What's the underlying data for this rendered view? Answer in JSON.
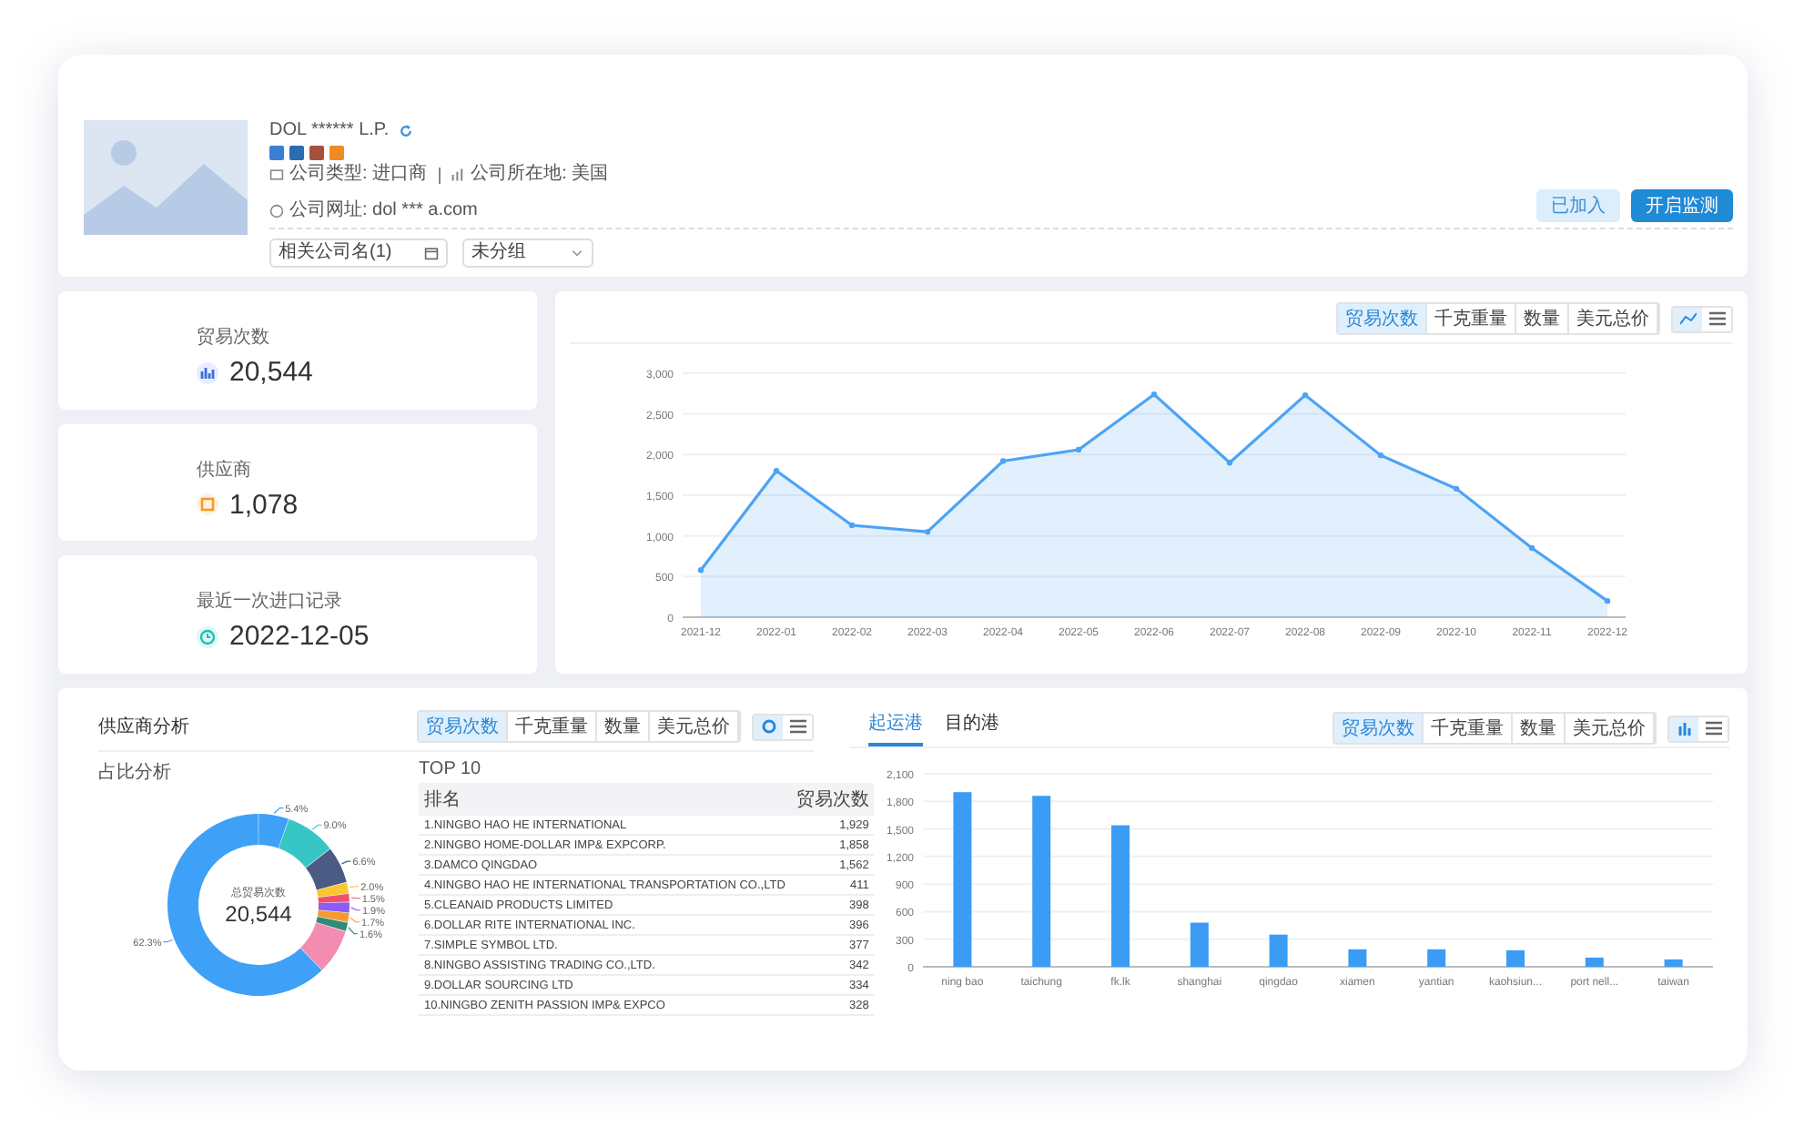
{
  "company": {
    "name": "DOL ****** L.P.",
    "social_links": [
      {
        "color": "#3b7fd4"
      },
      {
        "color": "#2a6db5"
      },
      {
        "color": "#a8503e"
      },
      {
        "color": "#f08a24"
      }
    ],
    "details": [
      {
        "kind": "type",
        "text": "公司类型: 进口商"
      },
      {
        "kind": "location",
        "text": "公司所在地: 美国"
      },
      {
        "kind": "website",
        "text": "公司网址: dol *** a.com"
      }
    ],
    "selects": [
      {
        "kind": "date",
        "value": "相关公司名(1)"
      },
      {
        "kind": "dropdown",
        "value": "未分组"
      }
    ],
    "buttons": [
      {
        "label": "已加入",
        "kind": "secondary"
      },
      {
        "label": "开启监测",
        "kind": "primary"
      }
    ]
  },
  "stats": [
    {
      "kind": "trades",
      "label": "贸易次数",
      "value": "20,544"
    },
    {
      "kind": "suppliers",
      "label": "供应商",
      "value": "1,078"
    },
    {
      "kind": "latest",
      "label": "最近一次进口记录",
      "value": "2022-12-05"
    }
  ],
  "trend": {
    "metric_tabs": [
      {
        "label": "贸易次数",
        "selected": true
      },
      {
        "label": "千克重量",
        "selected": false
      },
      {
        "label": "数量",
        "selected": false
      },
      {
        "label": "美元总价",
        "selected": false
      }
    ],
    "views": [
      {
        "kind": "line",
        "selected": true
      },
      {
        "kind": "table",
        "selected": false
      }
    ],
    "chart_data": {
      "type": "area",
      "categories": [
        "2021-12",
        "2022-01",
        "2022-02",
        "2022-03",
        "2022-04",
        "2022-05",
        "2022-06",
        "2022-07",
        "2022-08",
        "2022-09",
        "2022-10",
        "2022-11",
        "2022-12"
      ],
      "grid": true,
      "series": [
        {
          "color": "#4da3f5",
          "values": [
            580,
            1800,
            1130,
            1050,
            1920,
            2060,
            2740,
            1900,
            2730,
            1990,
            1580,
            850,
            200
          ]
        }
      ],
      "ylim": [
        0,
        3000
      ],
      "yticks": [
        {
          "value": 0,
          "label": "0"
        },
        {
          "value": 500,
          "label": "500"
        },
        {
          "value": 1000,
          "label": "1,000"
        },
        {
          "value": 1500,
          "label": "1,500"
        },
        {
          "value": 2000,
          "label": "2,000"
        },
        {
          "value": 2500,
          "label": "2,500"
        },
        {
          "value": 3000,
          "label": "3,000"
        }
      ]
    }
  },
  "suppliers": {
    "title": "供应商分析",
    "metric_tabs": [
      {
        "label": "贸易次数",
        "selected": true
      },
      {
        "label": "千克重量",
        "selected": false
      },
      {
        "label": "数量",
        "selected": false
      },
      {
        "label": "美元总价",
        "selected": false
      }
    ],
    "views": [
      {
        "kind": "donut",
        "selected": true
      },
      {
        "kind": "table",
        "selected": false
      }
    ],
    "share_title": "占比分析",
    "center_label": "总贸易次数",
    "center_value": "20,544",
    "chart_data": {
      "type": "donut",
      "series": [
        {
          "values": [
            5.4,
            9.0,
            6.6,
            2.0,
            1.5,
            1.9,
            1.7,
            1.6,
            8.0,
            62.3
          ]
        }
      ],
      "colors": [
        "#3fa0f7",
        "#36c6c6",
        "#4b5b84",
        "#fac730",
        "#f0506e",
        "#8b5cf6",
        "#f59b2f",
        "#2e8b7a",
        "#f28cb1",
        "#3fa0f7"
      ],
      "value_labels": [
        "5.4%",
        "9.0%",
        "6.6%",
        "2.0%",
        "1.5%",
        "1.9%",
        "1.7%",
        "1.6%",
        null,
        "62.3%"
      ]
    },
    "top_title": "TOP 10",
    "columns": [
      "排名",
      "贸易次数"
    ],
    "rows": [
      [
        "1.NINGBO HAO HE INTERNATIONAL",
        "1,929"
      ],
      [
        "2.NINGBO HOME-DOLLAR IMP& EXPCORP.",
        "1,858"
      ],
      [
        "3.DAMCO QINGDAO",
        "1,562"
      ],
      [
        "4.NINGBO HAO HE INTERNATIONAL TRANSPORTATION CO.,LTD",
        "411"
      ],
      [
        "5.CLEANAID PRODUCTS LIMITED",
        "398"
      ],
      [
        "6.DOLLAR RITE INTERNATIONAL INC.",
        "396"
      ],
      [
        "7.SIMPLE SYMBOL LTD.",
        "377"
      ],
      [
        "8.NINGBO ASSISTING TRADING CO.,LTD.",
        "342"
      ],
      [
        "9.DOLLAR SOURCING LTD",
        "334"
      ],
      [
        "10.NINGBO ZENITH PASSION IMP& EXPCO",
        "328"
      ]
    ]
  },
  "ports": {
    "tabs": [
      {
        "label": "起运港",
        "selected": true
      },
      {
        "label": "目的港",
        "selected": false
      }
    ],
    "metric_tabs": [
      {
        "label": "贸易次数",
        "selected": true
      },
      {
        "label": "千克重量",
        "selected": false
      },
      {
        "label": "数量",
        "selected": false
      },
      {
        "label": "美元总价",
        "selected": false
      }
    ],
    "views": [
      {
        "kind": "bar",
        "selected": true
      },
      {
        "kind": "table",
        "selected": false
      }
    ],
    "chart_data": {
      "type": "bar",
      "categories": [
        "ning bao",
        "taichung",
        "fk.lk",
        "shanghai",
        "qingdao",
        "xiamen",
        "yantian",
        "kaohsiun...",
        "port nell...",
        "taiwan"
      ],
      "grid": true,
      "series": [
        {
          "color": "#3a9cf5",
          "values": [
            1900,
            1860,
            1540,
            480,
            350,
            190,
            190,
            180,
            100,
            80
          ]
        }
      ],
      "ylim": [
        0,
        2100
      ],
      "yticks": [
        {
          "value": 0,
          "label": "0"
        },
        {
          "value": 300,
          "label": "300"
        },
        {
          "value": 600,
          "label": "600"
        },
        {
          "value": 900,
          "label": "900"
        },
        {
          "value": 1200,
          "label": "1,200"
        },
        {
          "value": 1500,
          "label": "1,500"
        },
        {
          "value": 1800,
          "label": "1,800"
        },
        {
          "value": 2100,
          "label": "2,100"
        }
      ]
    }
  }
}
